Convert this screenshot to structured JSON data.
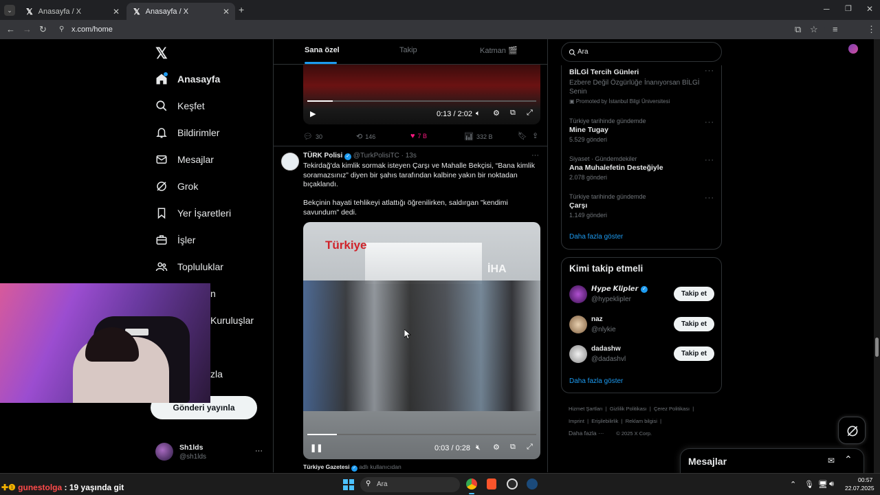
{
  "browser": {
    "tabs": [
      {
        "title": "Anasayfa / X"
      },
      {
        "title": "Anasayfa / X"
      }
    ],
    "url": "x.com/home"
  },
  "nav": {
    "items": [
      {
        "label": "Anasayfa"
      },
      {
        "label": "Keşfet"
      },
      {
        "label": "Bildirimler"
      },
      {
        "label": "Mesajlar"
      },
      {
        "label": "Grok"
      },
      {
        "label": "Yer İşaretleri"
      },
      {
        "label": "İşler"
      },
      {
        "label": "Topluluklar"
      }
    ],
    "partial_labels": [
      "n",
      "Kuruluşlar",
      "zla"
    ],
    "post_button": "Gönderi yayınla",
    "profile": {
      "name": "Sh1lds",
      "handle": "@sh1lds"
    }
  },
  "feed": {
    "tabs": [
      "Sana özel",
      "Takip",
      "Katman 🎬"
    ],
    "first_post": {
      "video_time": "0:13 / 2:02",
      "video_progress": 0.11,
      "metrics": {
        "replies": "30",
        "reposts": "146",
        "likes": "7 B",
        "views": "332 B"
      }
    },
    "second_post": {
      "author": "TÜRK Polisi",
      "handle": "@TurkPolisiTC",
      "time": "· 13s",
      "text1": "Tekirdağ'da kimlik sormak isteyen Çarşı ve Mahalle Bekçisi, “Bana kimlik soramazsınız” diyen bir şahıs tarafından kalbine yakın bir noktadan bıçaklandı.",
      "text2": "Bekçinin hayati tehlikeyi atlattığı öğrenilirken, saldırgan \"kendimi savundum\" dedi.",
      "video_logo": "Türkiye",
      "video_watermark": "İHA",
      "video_time": "0:03 / 0:28",
      "video_progress": 0.13,
      "source_name": "Türkiye Gazetesi",
      "source_suffix": "adlı kullanıcıdan"
    }
  },
  "sidebar": {
    "search_placeholder": "Ara",
    "promo": {
      "title": "BİLGİ Tercih Günleri",
      "body": "Ezbere Değil Özgürlüğe İnanıyorsan BİLGİ Senin",
      "promoted": "Promoted by İstanbul Bilgi Üniversitesi"
    },
    "trends": [
      {
        "context": "Türkiye tarihinde gündemde",
        "name": "Mine Tugay",
        "count": "5.529 gönderi"
      },
      {
        "context": "Siyaset · Gündemdekiler",
        "name": "Ana Muhalefetin Desteğiyle",
        "count": "2.078 gönderi"
      },
      {
        "context": "Türkiye tarihinde gündemde",
        "name": "Çarşı",
        "count": "1.149 gönderi"
      }
    ],
    "show_more": "Daha fazla göster",
    "who_to_follow": {
      "title": "Kimi takip etmeli",
      "users": [
        {
          "name": "𝙃𝙮𝙥𝙚 𝙆𝙡𝙞𝙥𝙡𝙚𝙧",
          "handle": "@hypeklipler",
          "button": "Takip et"
        },
        {
          "name": "naz",
          "handle": "@nlykie",
          "button": "Takip et"
        },
        {
          "name": "dadashw",
          "handle": "@dadashvl",
          "button": "Takip et"
        }
      ],
      "show_more": "Daha fazla göster"
    },
    "footer": [
      "Hizmet Şartları",
      "Gizlilik Politikası",
      "Çerez Politikası",
      "Imprint",
      "Erişilebilirlik",
      "Reklam bilgisi",
      "Daha fazla ···",
      "© 2025 X Corp."
    ]
  },
  "messages_drawer": {
    "title": "Mesajlar"
  },
  "stream_overlay": {
    "chat_user": "gunestolga",
    "chat_text": ": 19 yaşında git",
    "chat_prefix": "✚❶"
  },
  "taskbar": {
    "search": "Ara",
    "time": "00:57",
    "date": "22.07.2025"
  },
  "colors": {
    "accent": "#1d9bf0",
    "like": "#f91880",
    "bg": "#000000",
    "border": "#2f3336"
  }
}
